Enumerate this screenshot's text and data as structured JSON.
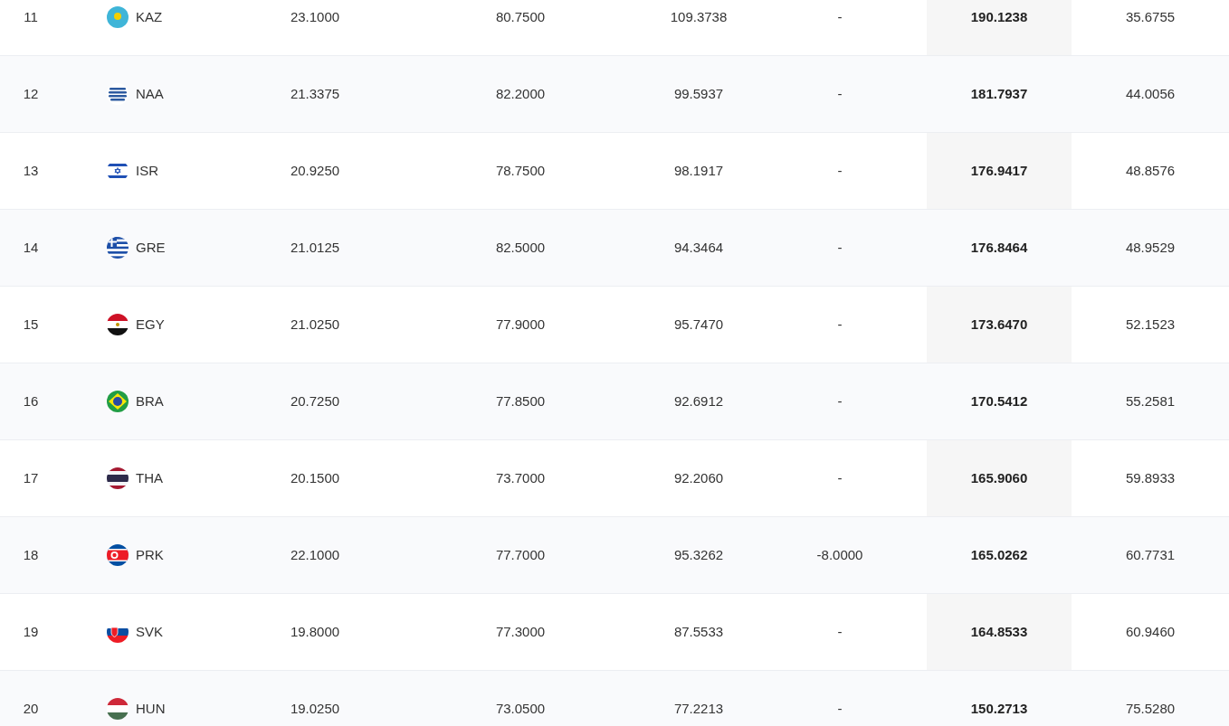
{
  "rows": [
    {
      "rank": "11",
      "country": "KAZ",
      "column_3": "23.1000",
      "column_4": "80.7500",
      "column_5": "109.3738",
      "column_6": "-",
      "column_7": "190.1238",
      "column_8": "35.6755"
    },
    {
      "rank": "12",
      "country": "NAA",
      "column_3": "21.3375",
      "column_4": "82.2000",
      "column_5": "99.5937",
      "column_6": "-",
      "column_7": "181.7937",
      "column_8": "44.0056"
    },
    {
      "rank": "13",
      "country": "ISR",
      "column_3": "20.9250",
      "column_4": "78.7500",
      "column_5": "98.1917",
      "column_6": "-",
      "column_7": "176.9417",
      "column_8": "48.8576"
    },
    {
      "rank": "14",
      "country": "GRE",
      "column_3": "21.0125",
      "column_4": "82.5000",
      "column_5": "94.3464",
      "column_6": "-",
      "column_7": "176.8464",
      "column_8": "48.9529"
    },
    {
      "rank": "15",
      "country": "EGY",
      "column_3": "21.0250",
      "column_4": "77.9000",
      "column_5": "95.7470",
      "column_6": "-",
      "column_7": "173.6470",
      "column_8": "52.1523"
    },
    {
      "rank": "16",
      "country": "BRA",
      "column_3": "20.7250",
      "column_4": "77.8500",
      "column_5": "92.6912",
      "column_6": "-",
      "column_7": "170.5412",
      "column_8": "55.2581"
    },
    {
      "rank": "17",
      "country": "THA",
      "column_3": "20.1500",
      "column_4": "73.7000",
      "column_5": "92.2060",
      "column_6": "-",
      "column_7": "165.9060",
      "column_8": "59.8933"
    },
    {
      "rank": "18",
      "country": "PRK",
      "column_3": "22.1000",
      "column_4": "77.7000",
      "column_5": "95.3262",
      "column_6": "-8.0000",
      "column_7": "165.0262",
      "column_8": "60.7731"
    },
    {
      "rank": "19",
      "country": "SVK",
      "column_3": "19.8000",
      "column_4": "77.3000",
      "column_5": "87.5533",
      "column_6": "-",
      "column_7": "164.8533",
      "column_8": "60.9460"
    },
    {
      "rank": "20",
      "country": "HUN",
      "column_3": "19.0250",
      "column_4": "73.0500",
      "column_5": "77.2213",
      "column_6": "-",
      "column_7": "150.2713",
      "column_8": "75.5280"
    }
  ]
}
